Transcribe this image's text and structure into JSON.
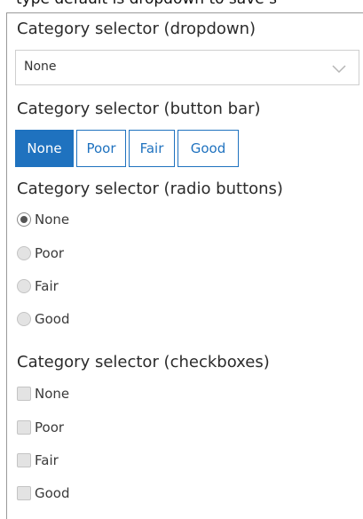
{
  "top_partial_text": "type default is dropdown to save s",
  "dropdown_section": {
    "title": "Category selector (dropdown)",
    "selected_value": "None",
    "arrow_icon": "chevron-down-icon"
  },
  "buttonbar_section": {
    "title": "Category selector (button bar)",
    "buttons": [
      "None",
      "Poor",
      "Fair",
      "Good"
    ],
    "selected": "None",
    "accent_color": "#1f72bf"
  },
  "radio_section": {
    "title": "Category selector (radio buttons)",
    "options": [
      "None",
      "Poor",
      "Fair",
      "Good"
    ],
    "selected": "None"
  },
  "checkbox_section": {
    "title": "Category selector (checkboxes)",
    "options": [
      "None",
      "Poor",
      "Fair",
      "Good"
    ],
    "checked": []
  }
}
